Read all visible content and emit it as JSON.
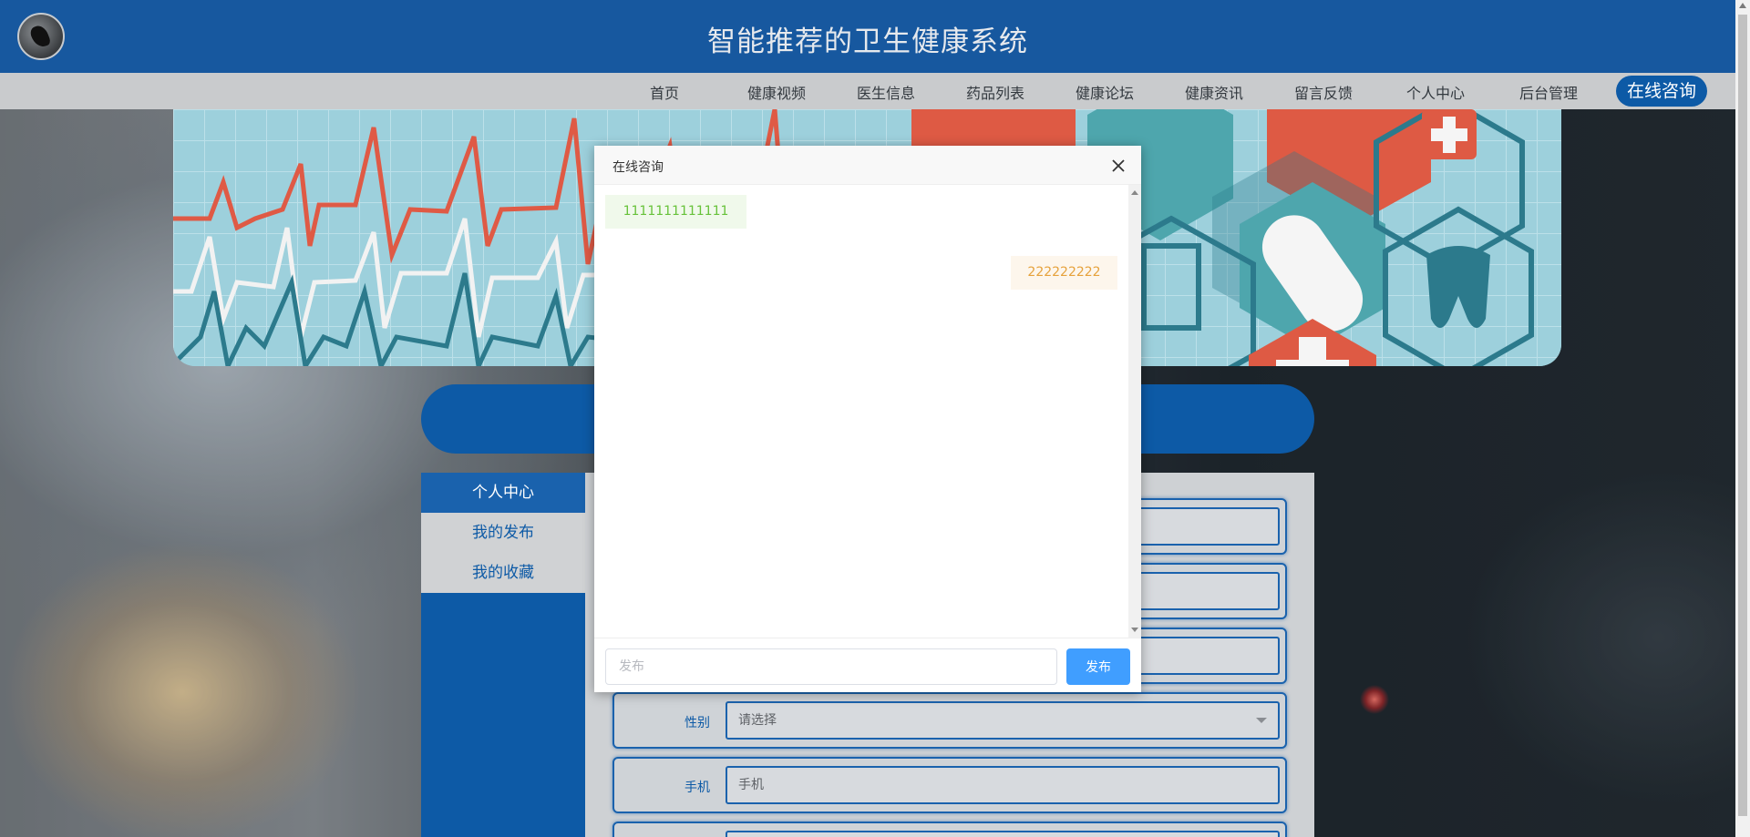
{
  "header": {
    "site_title": "智能推荐的卫生健康系统"
  },
  "nav": {
    "items": [
      "首页",
      "健康视频",
      "医生信息",
      "药品列表",
      "健康论坛",
      "健康资讯",
      "留言反馈",
      "个人中心",
      "后台管理"
    ],
    "consult_label": "在线咨询"
  },
  "sidebar": {
    "items": [
      {
        "label": "个人中心",
        "active": true
      },
      {
        "label": "我的发布",
        "active": false
      },
      {
        "label": "我的收藏",
        "active": false
      }
    ]
  },
  "form": {
    "gender": {
      "label": "性别",
      "placeholder": "请选择"
    },
    "phone": {
      "label": "手机",
      "placeholder": "手机"
    }
  },
  "modal": {
    "title": "在线咨询",
    "messages": [
      {
        "side": "left",
        "text": "1111111111111"
      },
      {
        "side": "right",
        "text": "222222222"
      }
    ],
    "input_placeholder": "发布",
    "send_label": "发布"
  },
  "colors": {
    "primary": "#0d5aa6",
    "header": "#17589f",
    "send_button": "#409eff",
    "msg_left_text": "#67c23a",
    "msg_right_text": "#e6a23c"
  }
}
